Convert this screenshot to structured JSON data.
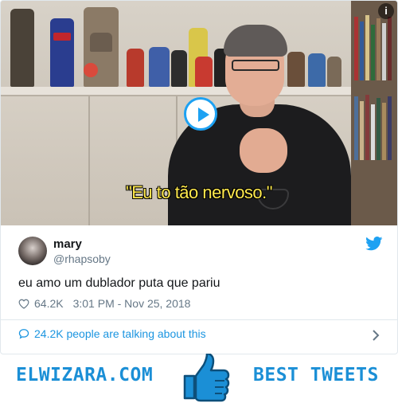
{
  "media": {
    "subtitle": "\"Eu to tão nervoso.\"",
    "info_label": "i"
  },
  "tweet": {
    "display_name": "mary",
    "handle": "@rhapsoby",
    "text": "eu amo um dublador puta que pariu",
    "likes": "64.2K",
    "timestamp": "3:01 PM - Nov 25, 2018",
    "talking": "24.2K people are talking about this"
  },
  "banner": {
    "left_text": "ELWIZARA.COM",
    "right_text": "BEST TWEETS"
  },
  "colors": {
    "twitter_blue": "#1da1f2",
    "link_blue": "#1b95e0",
    "brand_blue": "#1b8fd6",
    "subtitle_yellow": "#ffe94d"
  },
  "icons": [
    "info-icon",
    "play-icon",
    "twitter-bird-icon",
    "heart-icon",
    "speech-bubble-icon",
    "chevron-right-icon",
    "thumbs-up-icon"
  ]
}
